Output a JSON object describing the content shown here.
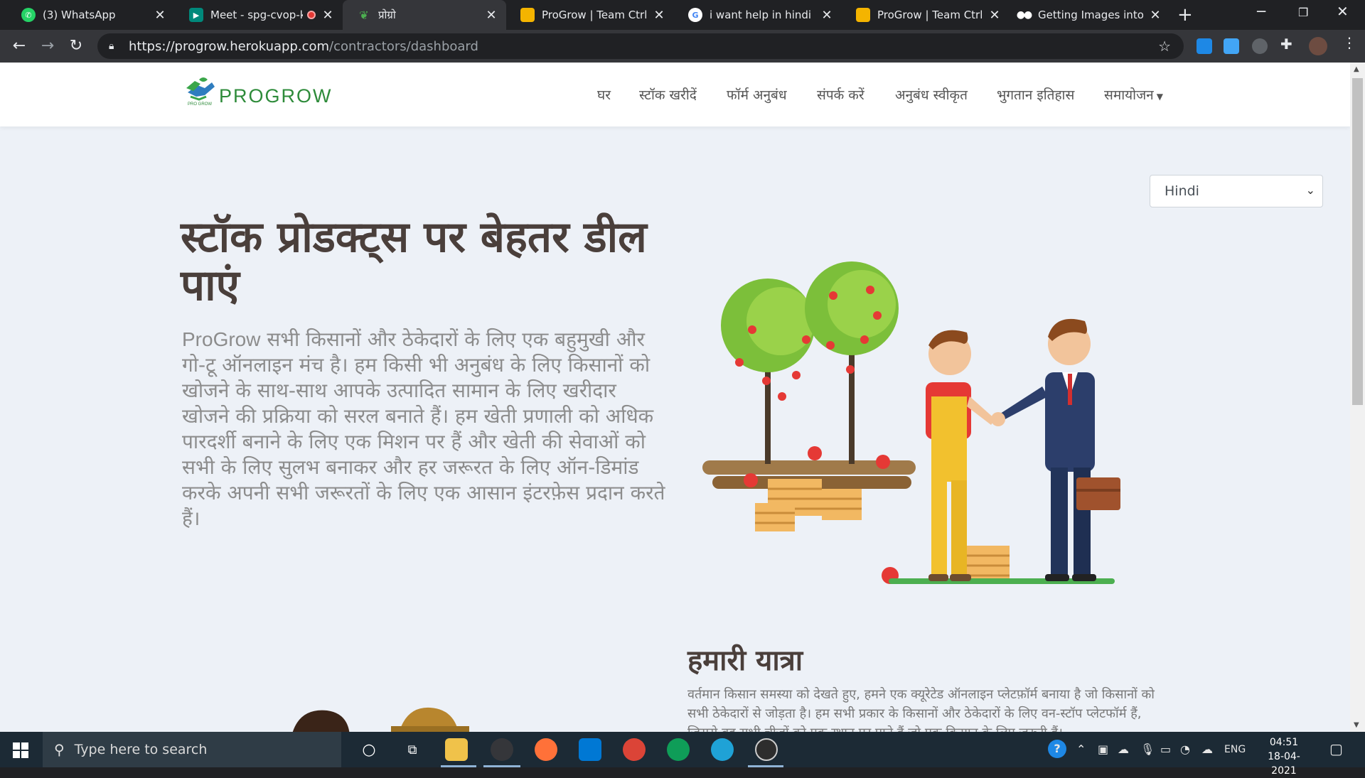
{
  "browser": {
    "tabs": [
      {
        "title": "(3) WhatsApp",
        "favicon": "whatsapp-icon",
        "color": "#25d366"
      },
      {
        "title": "Meet - spg-cvop-k",
        "favicon": "google-meet-icon",
        "color": "#00897b",
        "recording": true
      },
      {
        "title": "प्रोग्रो",
        "favicon": "progrow-leaf-icon",
        "color": "#35363a",
        "active": true
      },
      {
        "title": "ProGrow | Team Ctrl Int",
        "favicon": "google-slides-icon",
        "color": "#f4b400"
      },
      {
        "title": "i want help in hindi - G",
        "favicon": "google-icon",
        "color": "#ffffff"
      },
      {
        "title": "ProGrow | Team Ctrl Int",
        "favicon": "google-slides-icon",
        "color": "#f4b400"
      },
      {
        "title": "Getting Images into M",
        "favicon": "medium-icon",
        "color": "#000000"
      }
    ],
    "url_host": "https://progrow.herokuapp.com",
    "url_path": "/contractors/dashboard"
  },
  "site": {
    "brand": "PROGROW",
    "logo_sub": "PRO GROW",
    "nav": [
      {
        "label": "घर"
      },
      {
        "label": "स्टॉक खरीदें"
      },
      {
        "label": "फॉर्म अनुबंध"
      },
      {
        "label": "संपर्क करें"
      },
      {
        "label": "अनुबंध स्वीकृत"
      },
      {
        "label": "भुगतान इतिहास"
      },
      {
        "label": "समायोजन"
      }
    ],
    "language": "Hindi",
    "hero_title": "स्टॉक प्रोडक्ट्स पर बेहतर डील पाएं",
    "hero_text_brand": "ProGrow",
    "hero_text": " सभी किसानों और ठेकेदारों के लिए एक बहुमुखी और गो-टू ऑनलाइन मंच है। हम किसी भी अनुबंध के लिए किसानों को खोजने के साथ-साथ आपके उत्पादित सामान के लिए खरीदार खोजने की प्रक्रिया को सरल बनाते हैं। हम खेती प्रणाली को अधिक पारदर्शी बनाने के लिए एक मिशन पर हैं और खेती की सेवाओं को सभी के लिए सुलभ बनाकर और हर जरूरत के लिए ऑन-डिमांड करके अपनी सभी जरूरतों के लिए एक आसान इंटरफ़ेस प्रदान करते हैं।",
    "journey_title": "हमारी यात्रा",
    "journey_text": "वर्तमान किसान समस्या को देखते हुए, हमने एक क्यूरेटेड ऑनलाइन प्लेटफ़ॉर्म बनाया है जो किसानों को सभी ठेकेदारों से जोड़ता है। हम सभी प्रकार के किसानों और ठेकेदारों के लिए वन-स्टॉप प्लेटफॉर्म हैं, जिससे वह सभी चीजों को एक स्थान पर पाते हैं जो एक किसान के लिए जरूरी हैं।"
  },
  "taskbar": {
    "search_placeholder": "Type here to search",
    "language": "ENG",
    "time": "04:51",
    "date": "18-04-2021"
  }
}
